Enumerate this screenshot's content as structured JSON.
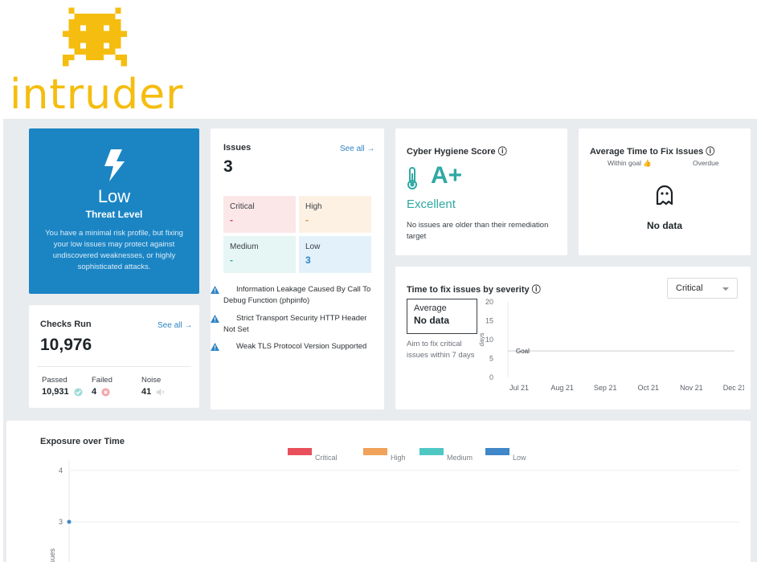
{
  "brand": {
    "name": "intruder",
    "color": "#f5bd10",
    "mascot_icon": "space-invader-icon"
  },
  "colors": {
    "accent": "#1b85c4",
    "critical": "#d8424f",
    "high": "#e58b2f",
    "medium": "#2fa9a3",
    "low": "#2f84c4",
    "background": "#e9ecef"
  },
  "threat": {
    "icon": "lightning-icon",
    "level": "Low",
    "title": "Threat Level",
    "description": "You have a minimal risk profile, but fixing your low issues may protect against undiscovered weaknesses, or highly sophisticated attacks."
  },
  "checks": {
    "title": "Checks Run",
    "see_all": "See all →",
    "total": "10,976",
    "passed_label": "Passed",
    "passed_value": "10,931",
    "failed_label": "Failed",
    "failed_value": "4",
    "noise_label": "Noise",
    "noise_value": "41"
  },
  "issues": {
    "title": "Issues",
    "see_all": "See all →",
    "total": "3",
    "critical_label": "Critical",
    "critical_value": "-",
    "high_label": "High",
    "high_value": "-",
    "medium_label": "Medium",
    "medium_value": "-",
    "low_label": "Low",
    "low_value": "3",
    "items": [
      "Information Leakage Caused By Call To Debug Function (phpinfo)",
      "Strict Transport Security HTTP Header Not Set",
      "Weak TLS Protocol Version Supported"
    ]
  },
  "hygiene": {
    "title": "Cyber Hygiene Score ⓘ",
    "grade": "A+",
    "rating": "Excellent",
    "note": "No issues are older than their remediation target",
    "icon": "thermometer-icon"
  },
  "avg_time": {
    "title": "Average Time to Fix Issues ⓘ",
    "within_goal": "Within goal 👍",
    "overdue": "Overdue",
    "icon": "ghost-icon",
    "no_data": "No data"
  },
  "time_to_fix": {
    "title": "Time to fix issues by severity ⓘ",
    "selected_severity": "Critical",
    "average_label": "Average",
    "average_value": "No data",
    "aim_text": "Aim to fix critical issues within 7 days",
    "chart_data": {
      "type": "line",
      "x": [
        "Jul 21",
        "Aug 21",
        "Sep 21",
        "Oct 21",
        "Nov 21",
        "Dec 21"
      ],
      "y_ticks": [
        0,
        5,
        10,
        15,
        20
      ],
      "ylim": [
        0,
        20
      ],
      "ylabel": "days",
      "goal_label": "Goal",
      "goal_value": 7,
      "series": []
    }
  },
  "exposure": {
    "title": "Exposure over Time",
    "chart_data": {
      "type": "area",
      "ylabel": "Issues",
      "y_ticks": [
        3,
        4
      ],
      "legend_position": "top",
      "series": [
        {
          "name": "Critical",
          "color": "#e8505b"
        },
        {
          "name": "High",
          "color": "#f0a35a"
        },
        {
          "name": "Medium",
          "color": "#4fc8c4"
        },
        {
          "name": "Low",
          "color": "#3f87c8"
        }
      ],
      "points": [
        {
          "y": 3
        }
      ]
    }
  }
}
